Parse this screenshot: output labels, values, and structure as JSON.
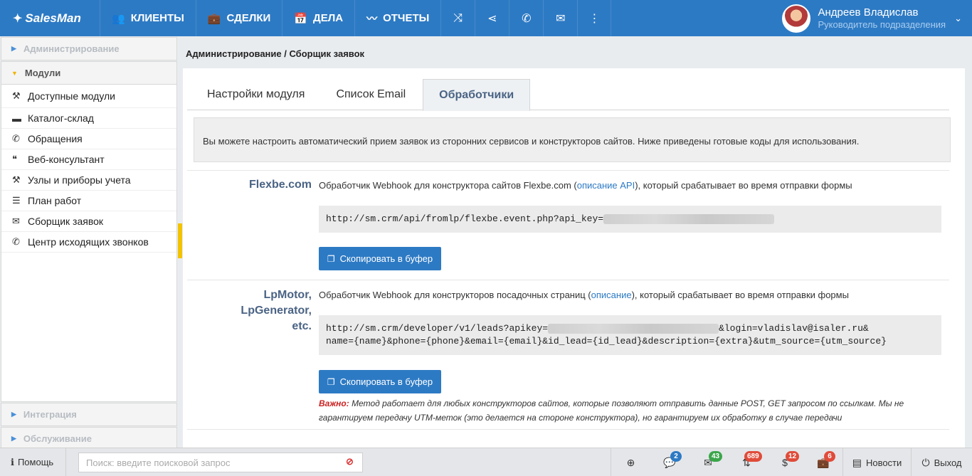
{
  "app": {
    "logo": "SalesMan"
  },
  "nav": [
    {
      "label": "КЛИЕНТЫ",
      "icon": "users-icon"
    },
    {
      "label": "СДЕЛКИ",
      "icon": "briefcase-icon"
    },
    {
      "label": "ДЕЛА",
      "icon": "calendar-icon"
    },
    {
      "label": "ОТЧЕТЫ",
      "icon": "chart-icon"
    }
  ],
  "nav_icons": [
    "shuffle-icon",
    "share-icon",
    "phone-icon",
    "mail-icon",
    "more-icon"
  ],
  "user": {
    "name": "Андреев Владислав",
    "role": "Руководитель подразделения"
  },
  "sidebar": {
    "sections": [
      {
        "label": "Администрирование"
      },
      {
        "label": "Модули"
      },
      {
        "label": "Интеграция"
      },
      {
        "label": "Обслуживание"
      }
    ],
    "items": [
      {
        "label": "Доступные модули",
        "icon": "tools-icon"
      },
      {
        "label": "Каталог-склад",
        "icon": "box-icon"
      },
      {
        "label": "Обращения",
        "icon": "phone-square-icon"
      },
      {
        "label": "Веб-консультант",
        "icon": "chat-icon"
      },
      {
        "label": "Узлы и приборы учета",
        "icon": "wrench-icon"
      },
      {
        "label": "План работ",
        "icon": "list-icon"
      },
      {
        "label": "Сборщик заявок",
        "icon": "envelope-icon"
      },
      {
        "label": "Центр исходящих звонков",
        "icon": "phone-icon"
      }
    ]
  },
  "breadcrumb": "Администрирование / Сборщик заявок",
  "tabs": [
    {
      "label": "Настройки модуля"
    },
    {
      "label": "Список Email"
    },
    {
      "label": "Обработчики"
    }
  ],
  "info": "Вы можете настроить автоматический прием заявок из сторонних сервисов и конструкторов сайтов. Ниже приведены готовые коды для использования.",
  "handlers": [
    {
      "name": "Flexbe.com",
      "desc_before": "Обработчик Webhook для конструктора сайтов Flexbe.com (",
      "link": "описание API",
      "desc_after": "), который срабатывает во время отправки формы",
      "code": "http://sm.crm/api/fromlp/flexbe.event.php?api_key=",
      "button": "Скопировать в буфер"
    },
    {
      "name_lines": [
        "LpMotor,",
        "LpGenerator,",
        "etc."
      ],
      "desc_before": "Обработчик Webhook для конструкторов посадочных страниц (",
      "link": "описание",
      "desc_after": "), который срабатывает во время отправки формы",
      "code_part1": "http://sm.crm/developer/v1/leads?apikey=",
      "code_part2": "&login=vladislav@isaler.ru&",
      "code_line2": "name={name}&phone={phone}&email={email}&id_lead={id_lead}&description={extra}&utm_source={utm_source}",
      "button": "Скопировать в буфер"
    }
  ],
  "note": {
    "label": "Важно:",
    "text": " Метод работает для любых конструкторов сайтов, которые позволяют отправить данные POST, GET запросом по ссылкам. Мы не гарантируем передачу UTM-меток (это делается на стороне конструктора), но гарантируем их обработку в случае передачи"
  },
  "bottom": {
    "help": "Помощь",
    "search_placeholder": "Поиск: введите поисковой запрос",
    "badges": [
      {
        "icon": "comments-icon",
        "count": "2",
        "color": "#2d7ac4"
      },
      {
        "icon": "envelope-icon",
        "count": "43",
        "color": "#3aa64a"
      },
      {
        "icon": "sort-icon",
        "count": "689",
        "color": "#e04b3a"
      },
      {
        "icon": "dollar-icon",
        "count": "12",
        "color": "#e04b3a"
      },
      {
        "icon": "briefcase-icon",
        "count": "6",
        "color": "#e04b3a"
      }
    ],
    "news": "Новости",
    "logout": "Выход"
  }
}
